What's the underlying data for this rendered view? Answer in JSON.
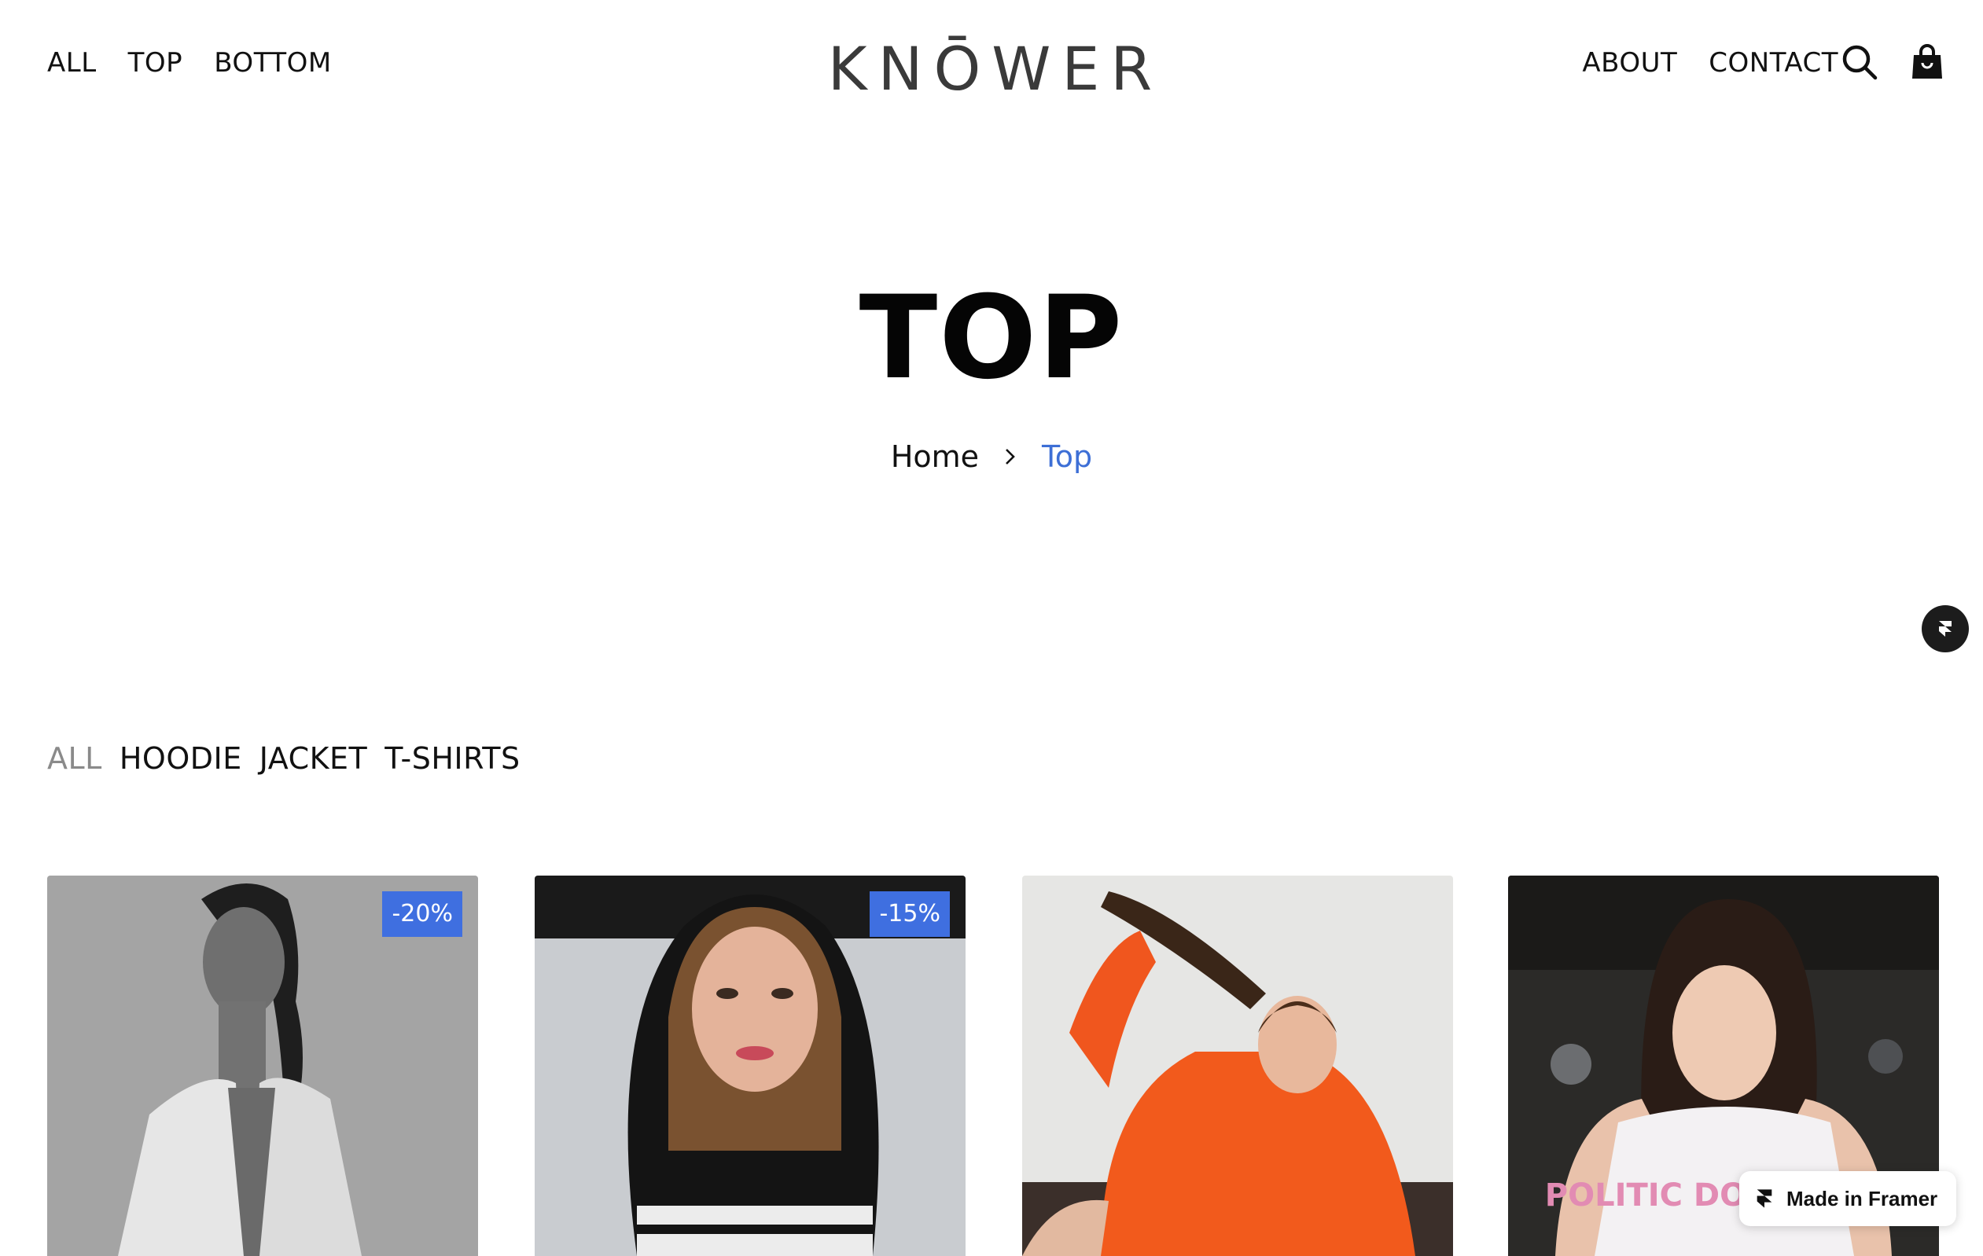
{
  "header": {
    "logo_text": "KNŌWER",
    "nav_left": [
      {
        "label": "ALL"
      },
      {
        "label": "TOP"
      },
      {
        "label": "BOTTOM"
      }
    ],
    "nav_right": [
      {
        "label": "ABOUT"
      },
      {
        "label": "CONTACT"
      }
    ],
    "icons": [
      "search-icon",
      "shopping-bag-icon"
    ]
  },
  "hero": {
    "title": "TOP",
    "breadcrumb": {
      "home": "Home",
      "current": "Top"
    }
  },
  "filters": [
    {
      "label": "ALL",
      "active": true
    },
    {
      "label": "HOODIE",
      "active": false
    },
    {
      "label": "JACKET",
      "active": false
    },
    {
      "label": "T-SHIRTS",
      "active": false
    }
  ],
  "products": [
    {
      "badge": "-20%",
      "image": "woman in white blazer, grayscale"
    },
    {
      "badge": "-15%",
      "image": "woman in black hoodie"
    },
    {
      "badge": "",
      "image": "woman in orange hoodie"
    },
    {
      "badge": "",
      "image": "woman in white t-shirt",
      "shirt_text": "POLITIC DONT SURF"
    }
  ],
  "framer_badge": {
    "label": "Made in Framer"
  },
  "colors": {
    "accent": "#3f6fe0",
    "breadcrumb_current": "#3d6fd6",
    "text": "#111111",
    "filter_active": "#8a8a8a"
  }
}
